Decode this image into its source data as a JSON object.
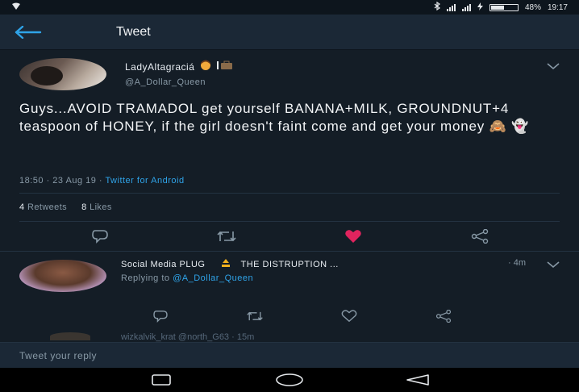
{
  "status_bar": {
    "battery": "48%",
    "time": "19:17"
  },
  "header": {
    "title": "Tweet"
  },
  "tweet": {
    "display_name": "LadyAltagraciá",
    "handle": "@A_Dollar_Queen",
    "text": "Guys...AVOID TRAMADOL get yourself BANANA+MILK, GROUNDNUT+4 teaspoon of HONEY, if the girl doesn't faint come and get your money 🙈 👻",
    "timestamp": "18:50 · 23 Aug 19 · ",
    "client": "Twitter for Android",
    "retweets_count": "4",
    "retweets_label": "Retweets",
    "likes_count": "8",
    "likes_label": "Likes"
  },
  "reply": {
    "display_name": "Social Media PLUG",
    "second_name": "THE DISTRUPTION ...",
    "time": "· 4m",
    "replying_prefix": "Replying to ",
    "replying_handle": "@A_Dollar_Queen"
  },
  "next_reply_partial": "wizkalvik_krat @north_G63 · 15m",
  "compose": {
    "placeholder": "Tweet your reply"
  },
  "colors": {
    "accent": "#2fa3e8",
    "like": "#e0245e",
    "background": "#141d26"
  }
}
